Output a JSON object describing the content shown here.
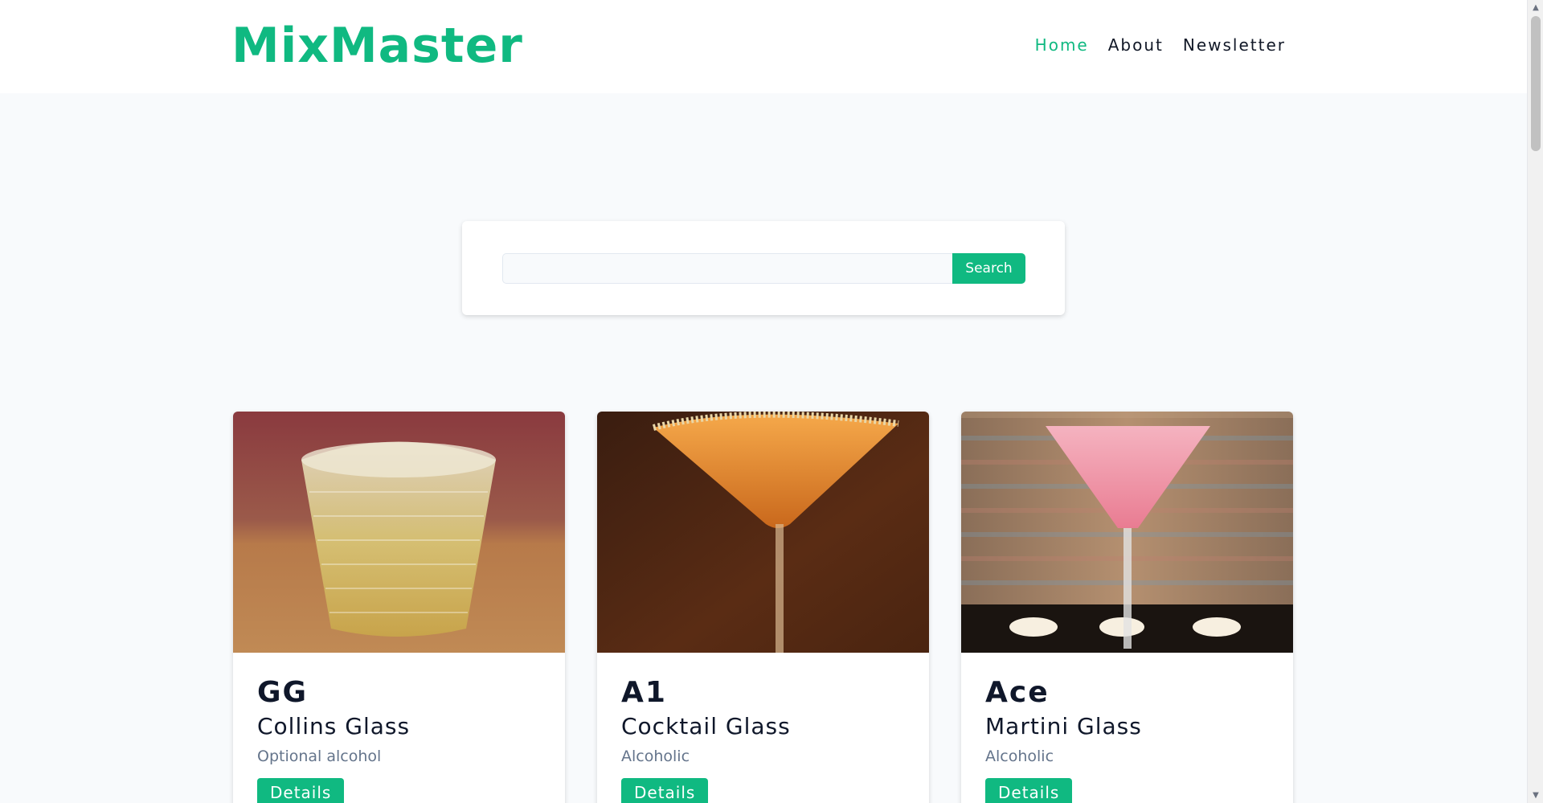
{
  "header": {
    "brand": "MixMaster",
    "nav": [
      {
        "label": "Home",
        "active": true
      },
      {
        "label": "About",
        "active": false
      },
      {
        "label": "Newsletter",
        "active": false
      }
    ]
  },
  "search": {
    "value": "",
    "placeholder": "",
    "button_label": "Search"
  },
  "cards": [
    {
      "name": "GG",
      "glass": "Collins Glass",
      "type": "Optional alcohol",
      "button_label": "Details",
      "image_icon": "cocktail-photo-icon"
    },
    {
      "name": "A1",
      "glass": "Cocktail Glass",
      "type": "Alcoholic",
      "button_label": "Details",
      "image_icon": "cocktail-photo-icon"
    },
    {
      "name": "Ace",
      "glass": "Martini Glass",
      "type": "Alcoholic",
      "button_label": "Details",
      "image_icon": "cocktail-photo-icon"
    }
  ],
  "colors": {
    "accent": "#10b981",
    "background": "#f8fafc",
    "text": "#0f172a",
    "muted": "#64748b"
  }
}
